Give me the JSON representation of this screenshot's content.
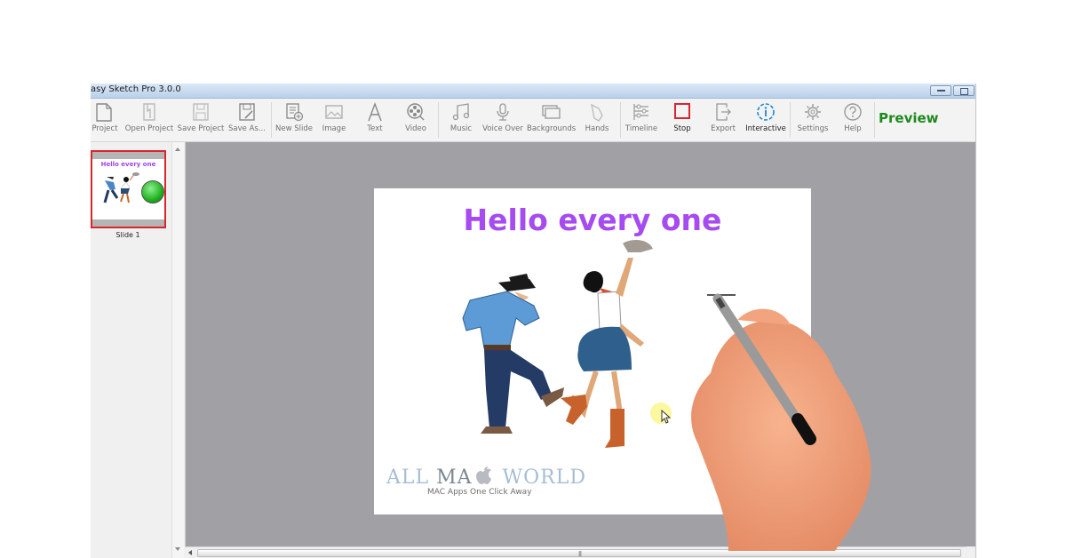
{
  "window": {
    "title": "asy Sketch Pro 3.0.0",
    "controls": [
      "minimize",
      "restore"
    ]
  },
  "toolbar": {
    "items": [
      {
        "label": "Project",
        "icon": "new-project-icon"
      },
      {
        "label": "Open Project",
        "icon": "open-project-icon"
      },
      {
        "label": "Save Project",
        "icon": "save-project-icon"
      },
      {
        "label": "Save As...",
        "icon": "save-as-icon"
      },
      {
        "label": "New Slide",
        "icon": "new-slide-icon"
      },
      {
        "label": "Image",
        "icon": "image-icon"
      },
      {
        "label": "Text",
        "icon": "text-icon"
      },
      {
        "label": "Video",
        "icon": "video-icon"
      },
      {
        "label": "Music",
        "icon": "music-icon"
      },
      {
        "label": "Voice Over",
        "icon": "microphone-icon"
      },
      {
        "label": "Backgrounds",
        "icon": "backgrounds-icon"
      },
      {
        "label": "Hands",
        "icon": "hand-icon"
      },
      {
        "label": "Timeline",
        "icon": "timeline-icon"
      },
      {
        "label": "Stop",
        "icon": "stop-icon"
      },
      {
        "label": "Export",
        "icon": "export-icon"
      },
      {
        "label": "Interactive",
        "icon": "info-icon"
      },
      {
        "label": "Settings",
        "icon": "gear-icon"
      },
      {
        "label": "Help",
        "icon": "help-icon"
      }
    ],
    "preview_label": "Preview",
    "colors": {
      "stop": "#d9262c",
      "interactive": "#1e88d0",
      "preview": "#1e8a1e"
    }
  },
  "sidebar": {
    "slides": [
      {
        "label": "Slide 1",
        "thumb_title": "Hello every one",
        "selected": true
      }
    ]
  },
  "slide": {
    "title": "Hello every one",
    "title_color": "#a64bf0",
    "watermark": {
      "line1_a": "ALL ",
      "line1_b": "MA",
      "line1_c": " WORLD",
      "line2": "MAC Apps One Click Away"
    }
  },
  "scrollbar": {
    "grip": "|||"
  }
}
